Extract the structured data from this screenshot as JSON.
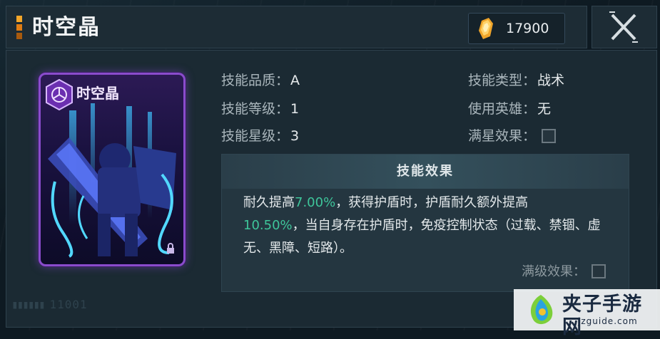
{
  "header": {
    "title": "时空晶",
    "currency_icon": "crystal-icon",
    "currency_amount": "17900",
    "close_icon": "close-icon"
  },
  "card": {
    "name": "时空晶",
    "badge_icon": "tactical-skill-icon",
    "accent_color": "#8a4ccc"
  },
  "stats_left": [
    {
      "label": "技能品质：",
      "value": "A"
    },
    {
      "label": "技能等级：",
      "value": "1"
    },
    {
      "label": "技能星级：",
      "value": "3"
    }
  ],
  "stats_right": [
    {
      "label": "技能类型：",
      "value": "战术"
    },
    {
      "label": "使用英雄：",
      "value": "无"
    },
    {
      "label": "满星效果：",
      "value": ""
    }
  ],
  "effect": {
    "title": "技能效果",
    "segments": [
      {
        "text": "耐久提高",
        "highlight": false
      },
      {
        "text": "7.00%",
        "highlight": true
      },
      {
        "text": "，获得护盾时，护盾耐久额外提高",
        "highlight": false
      },
      {
        "text": "10.50%",
        "highlight": true
      },
      {
        "text": "，当自身存在护盾时，免疫控制状态（过载、禁锢、虚无、黑障、短路）。",
        "highlight": false
      }
    ],
    "max_level_label": "满级效果："
  },
  "footer": {
    "serial": "11001"
  },
  "watermark": {
    "text": "夹子手游网",
    "url": "jzguide.com"
  },
  "colors": {
    "highlight": "#3ec59a",
    "gold": "#f4a62a"
  }
}
